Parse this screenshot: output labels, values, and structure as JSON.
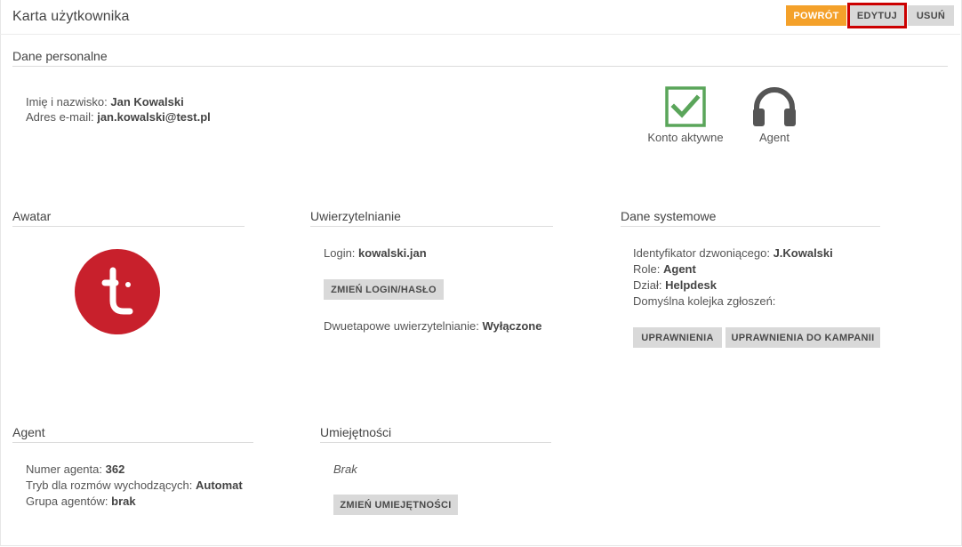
{
  "header": {
    "title": "Karta użytkownika",
    "back_label": "POWRÓT",
    "edit_label": "EDYTUJ",
    "delete_label": "USUŃ"
  },
  "personal": {
    "title": "Dane personalne",
    "name_label": "Imię i nazwisko:",
    "name_value": "Jan Kowalski",
    "email_label": "Adres e-mail:",
    "email_value": "jan.kowalski@test.pl",
    "status_active_label": "Konto aktywne",
    "status_agent_label": "Agent"
  },
  "avatar": {
    "title": "Awatar",
    "logo_icon": "t-logo-icon",
    "color": "#c8202c"
  },
  "auth": {
    "title": "Uwierzytelnianie",
    "login_label": "Login:",
    "login_value": "kowalski.jan",
    "change_login_button": "ZMIEŃ LOGIN/HASŁO",
    "twofa_label": "Dwuetapowe uwierzytelnianie:",
    "twofa_value": "Wyłączone"
  },
  "system": {
    "title": "Dane systemowe",
    "caller_id_label": "Identyfikator dzwoniącego:",
    "caller_id_value": "J.Kowalski",
    "role_label": "Role:",
    "role_value": "Agent",
    "department_label": "Dział:",
    "department_value": "Helpdesk",
    "queue_label": "Domyślna kolejka zgłoszeń:",
    "queue_value": "",
    "permissions_button": "UPRAWNIENIA",
    "campaign_permissions_button": "UPRAWNIENIA DO KAMPANII"
  },
  "agent": {
    "title": "Agent",
    "number_label": "Numer agenta:",
    "number_value": "362",
    "mode_label": "Tryb dla rozmów wychodzących:",
    "mode_value": "Automat",
    "group_label": "Grupa agentów:",
    "group_value": "brak"
  },
  "skills": {
    "title": "Umiejętności",
    "empty_text": "Brak",
    "change_button": "ZMIEŃ UMIEJĘTNOŚCI"
  },
  "colors": {
    "accent_orange": "#f4a12a",
    "button_gray": "#d9d9d9",
    "check_green": "#5aa55a",
    "highlight_red": "#cc0000"
  }
}
